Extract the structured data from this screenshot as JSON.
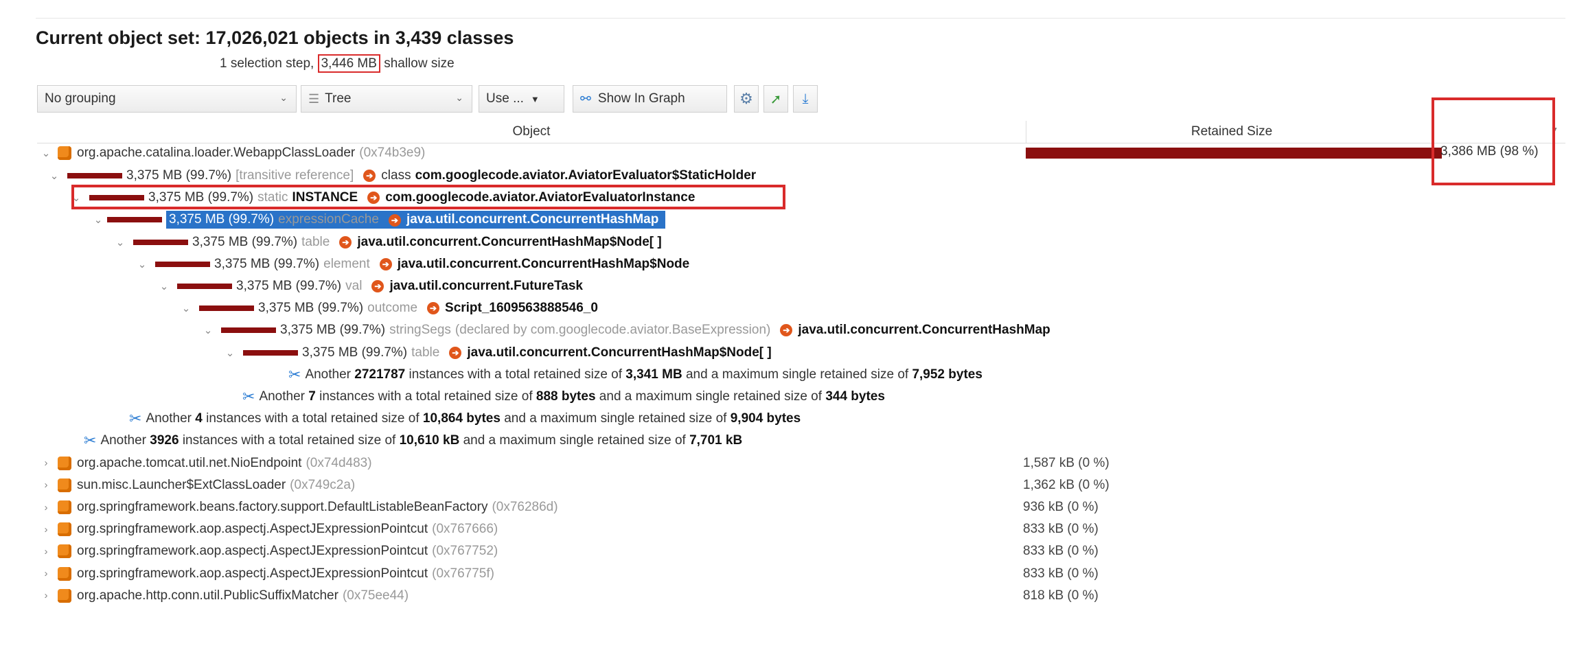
{
  "header": {
    "title": "Current object set:  17,026,021 objects in 3,439 classes",
    "subtitle_pre": "1 selection step, ",
    "subtitle_highlight": "3,446 MB",
    "subtitle_post": " shallow size"
  },
  "toolbar": {
    "grouping": "No grouping",
    "view": "Tree",
    "use": "Use ...",
    "show_in_graph": "Show In Graph"
  },
  "table": {
    "col_object": "Object",
    "col_retained": "Retained Size",
    "root": {
      "name": "org.apache.catalina.loader.WebappClassLoader",
      "id": "(0x74b3e9)",
      "size": "3,386 MB (98 %)",
      "percent": 98
    },
    "rows": [
      {
        "size": "3,375 MB (99.7%)",
        "ref": "[transitive reference]",
        "kw": "class",
        "cls": "com.googlecode.aviator.AviatorEvaluator$StaticHolder"
      },
      {
        "size": "3,375 MB (99.7%)",
        "ref": "static",
        "field": "INSTANCE",
        "cls": "com.googlecode.aviator.AviatorEvaluatorInstance"
      },
      {
        "size": "3,375 MB (99.7%)",
        "ref": "expressionCache",
        "cls": "java.util.concurrent.ConcurrentHashMap"
      },
      {
        "size": "3,375 MB (99.7%)",
        "ref": "table",
        "cls": "java.util.concurrent.ConcurrentHashMap$Node[ ]"
      },
      {
        "size": "3,375 MB (99.7%)",
        "ref": "element",
        "cls": "java.util.concurrent.ConcurrentHashMap$Node"
      },
      {
        "size": "3,375 MB (99.7%)",
        "ref": "val",
        "cls": "java.util.concurrent.FutureTask"
      },
      {
        "size": "3,375 MB (99.7%)",
        "ref": "outcome",
        "cls": "Script_1609563888546_0"
      },
      {
        "size": "3,375 MB (99.7%)",
        "ref": "stringSegs",
        "decl": "(declared by com.googlecode.aviator.BaseExpression)",
        "cls": "java.util.concurrent.ConcurrentHashMap"
      },
      {
        "size": "3,375 MB (99.7%)",
        "ref": "table",
        "cls": "java.util.concurrent.ConcurrentHashMap$Node[ ]"
      }
    ],
    "another": [
      {
        "pre": "Another ",
        "count": "2721787",
        "mid": " instances with a total retained size of ",
        "total": "3,341 MB",
        "mid2": " and a maximum single retained size of ",
        "max": "7,952 bytes"
      },
      {
        "pre": "Another ",
        "count": "7",
        "mid": " instances with a total retained size of ",
        "total": "888 bytes",
        "mid2": " and a maximum single retained size of ",
        "max": "344 bytes"
      },
      {
        "pre": "Another ",
        "count": "4",
        "mid": " instances with a total retained size of ",
        "total": "10,864 bytes",
        "mid2": " and a maximum single retained size of ",
        "max": "9,904 bytes"
      },
      {
        "pre": "Another ",
        "count": "3926",
        "mid": " instances with a total retained size of ",
        "total": "10,610 kB",
        "mid2": " and a maximum single retained size of ",
        "max": "7,701 kB"
      }
    ],
    "others": [
      {
        "name": "org.apache.tomcat.util.net.NioEndpoint",
        "id": "(0x74d483)",
        "size": "1,587 kB (0 %)"
      },
      {
        "name": "sun.misc.Launcher$ExtClassLoader",
        "id": "(0x749c2a)",
        "size": "1,362 kB (0 %)"
      },
      {
        "name": "org.springframework.beans.factory.support.DefaultListableBeanFactory",
        "id": "(0x76286d)",
        "size": "936 kB (0 %)"
      },
      {
        "name": "org.springframework.aop.aspectj.AspectJExpressionPointcut",
        "id": "(0x767666)",
        "size": "833 kB (0 %)"
      },
      {
        "name": "org.springframework.aop.aspectj.AspectJExpressionPointcut",
        "id": "(0x767752)",
        "size": "833 kB (0 %)"
      },
      {
        "name": "org.springframework.aop.aspectj.AspectJExpressionPointcut",
        "id": "(0x76775f)",
        "size": "833 kB (0 %)"
      },
      {
        "name": "org.apache.http.conn.util.PublicSuffixMatcher",
        "id": "(0x75ee44)",
        "size": "818 kB (0 %)"
      }
    ]
  },
  "colors": {
    "bar": "#8b0f0f",
    "highlight_box": "#d92b2b",
    "selection": "#2a73c8",
    "class_icon": "#f08a1c",
    "ref_arrow": "#e0561b"
  },
  "icons": [
    "expand-chevron-icon",
    "class-cube-icon",
    "reference-arrow-icon",
    "scissors-icon",
    "gear-icon",
    "export-icon",
    "import-icon",
    "graph-icon",
    "tree-icon"
  ]
}
